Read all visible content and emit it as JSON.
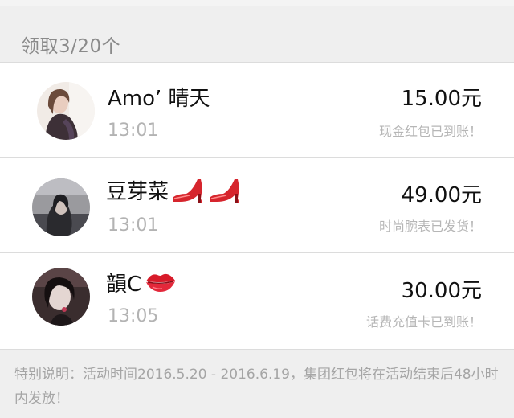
{
  "header": {
    "claim_summary": "领取3/20个"
  },
  "records": [
    {
      "name": "Amo’ 晴天",
      "emoji_icons": [],
      "time": "13:01",
      "amount": "15.00元",
      "status": "现金红包已到账！"
    },
    {
      "name": "豆芽菜",
      "emoji_icons": [
        "high-heel-icon",
        "high-heel-icon"
      ],
      "time": "13:01",
      "amount": "49.00元",
      "status": "时尚腕表已发货！"
    },
    {
      "name": "韻C",
      "emoji_icons": [
        "lips-icon"
      ],
      "time": "13:05",
      "amount": "30.00元",
      "status": "话费充值卡已到账！"
    }
  ],
  "footer": {
    "note": "特别说明：活动时间2016.5.20 - 2016.6.19，集团红包将在活动结束后48小时内发放！"
  },
  "colors": {
    "background": "#efefef",
    "card": "#ffffff",
    "primary_text": "#111111",
    "muted_text": "#b3b3b3",
    "divider": "#dcdcdc",
    "emoji_red": "#d6252d"
  }
}
